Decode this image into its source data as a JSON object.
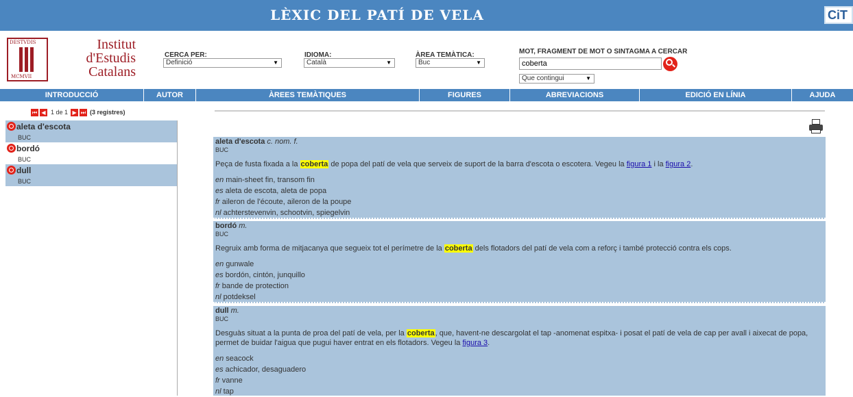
{
  "header": {
    "title": "LÈXIC DEL PATÍ DE VELA",
    "badge": "CiT"
  },
  "logo": {
    "seal_top": "DESTVDIS",
    "seal_bottom": "MCMVII",
    "line1": "Institut",
    "line2": "d'Estudis",
    "line3": "Catalans"
  },
  "search": {
    "cerca_label": "CERCA PER:",
    "cerca_value": "Definició",
    "idioma_label": "IDIOMA:",
    "idioma_value": "Català",
    "area_label": "ÀREA TEMÀTICA:",
    "area_value": "Buc",
    "mot_label": "MOT, FRAGMENT DE MOT O SINTAGMA A CERCAR",
    "query": "coberta",
    "mode_value": "Que contingui"
  },
  "nav": [
    "INTRODUCCIÓ",
    "AUTOR",
    "ÀREES TEMÀTIQUES",
    "FIGURES",
    "ABREVIACIONS",
    "EDICIÓ EN LÍNIA",
    "AJUDA"
  ],
  "pager": {
    "text": "1 de 1",
    "count": "(3 registres)"
  },
  "results": [
    {
      "term": "aleta d'escota",
      "area": "BUC"
    },
    {
      "term": "bordó",
      "area": "BUC"
    },
    {
      "term": "dull",
      "area": "BUC"
    }
  ],
  "entries": [
    {
      "term": "aleta d'escota",
      "cat": "c. nom. f.",
      "area": "BUC",
      "def_pre": "Peça de fusta fixada a la ",
      "highlight": "coberta",
      "def_post": " de popa del patí de vela que serveix de suport de la barra d'escota o escotera. Vegeu la ",
      "link1": "figura 1",
      "mid": " i la ",
      "link2": "figura 2",
      "end": ".",
      "equiv": [
        {
          "lang": "en",
          "text": " main-sheet fin, transom fin"
        },
        {
          "lang": "es",
          "text": " aleta de escota, aleta de popa"
        },
        {
          "lang": "fr",
          "text": " aileron de l'écoute, aileron de la poupe"
        },
        {
          "lang": "nl",
          "text": " achterstevenvin, schootvin, spiegelvin"
        }
      ]
    },
    {
      "term": "bordó",
      "cat": "m.",
      "area": "BUC",
      "def_pre": "Regruix amb forma de mitjacanya que segueix tot el perímetre de la ",
      "highlight": "coberta",
      "def_post": " dels flotadors del patí de vela com a reforç i també protecció contra els cops.",
      "equiv": [
        {
          "lang": "en",
          "text": " gunwale"
        },
        {
          "lang": "es",
          "text": " bordón, cintón, junquillo"
        },
        {
          "lang": "fr",
          "text": " bande de protection"
        },
        {
          "lang": "nl",
          "text": " potdeksel"
        }
      ]
    },
    {
      "term": "dull",
      "cat": "m.",
      "area": "BUC",
      "def_pre": "Desguàs situat a la punta de proa del patí de vela, per la ",
      "highlight": "coberta",
      "def_post": ", que, havent-ne descargolat el tap -anomenat espitxa- i posat el patí de vela de cap per avall i aixecat de popa, permet de buidar l'aigua que pugui haver entrat en els flotadors. Vegeu la ",
      "link1": "figura 3",
      "end": ".",
      "equiv": [
        {
          "lang": "en",
          "text": " seacock"
        },
        {
          "lang": "es",
          "text": " achicador, desaguadero"
        },
        {
          "lang": "fr",
          "text": " vanne"
        },
        {
          "lang": "nl",
          "text": " tap"
        }
      ]
    }
  ]
}
